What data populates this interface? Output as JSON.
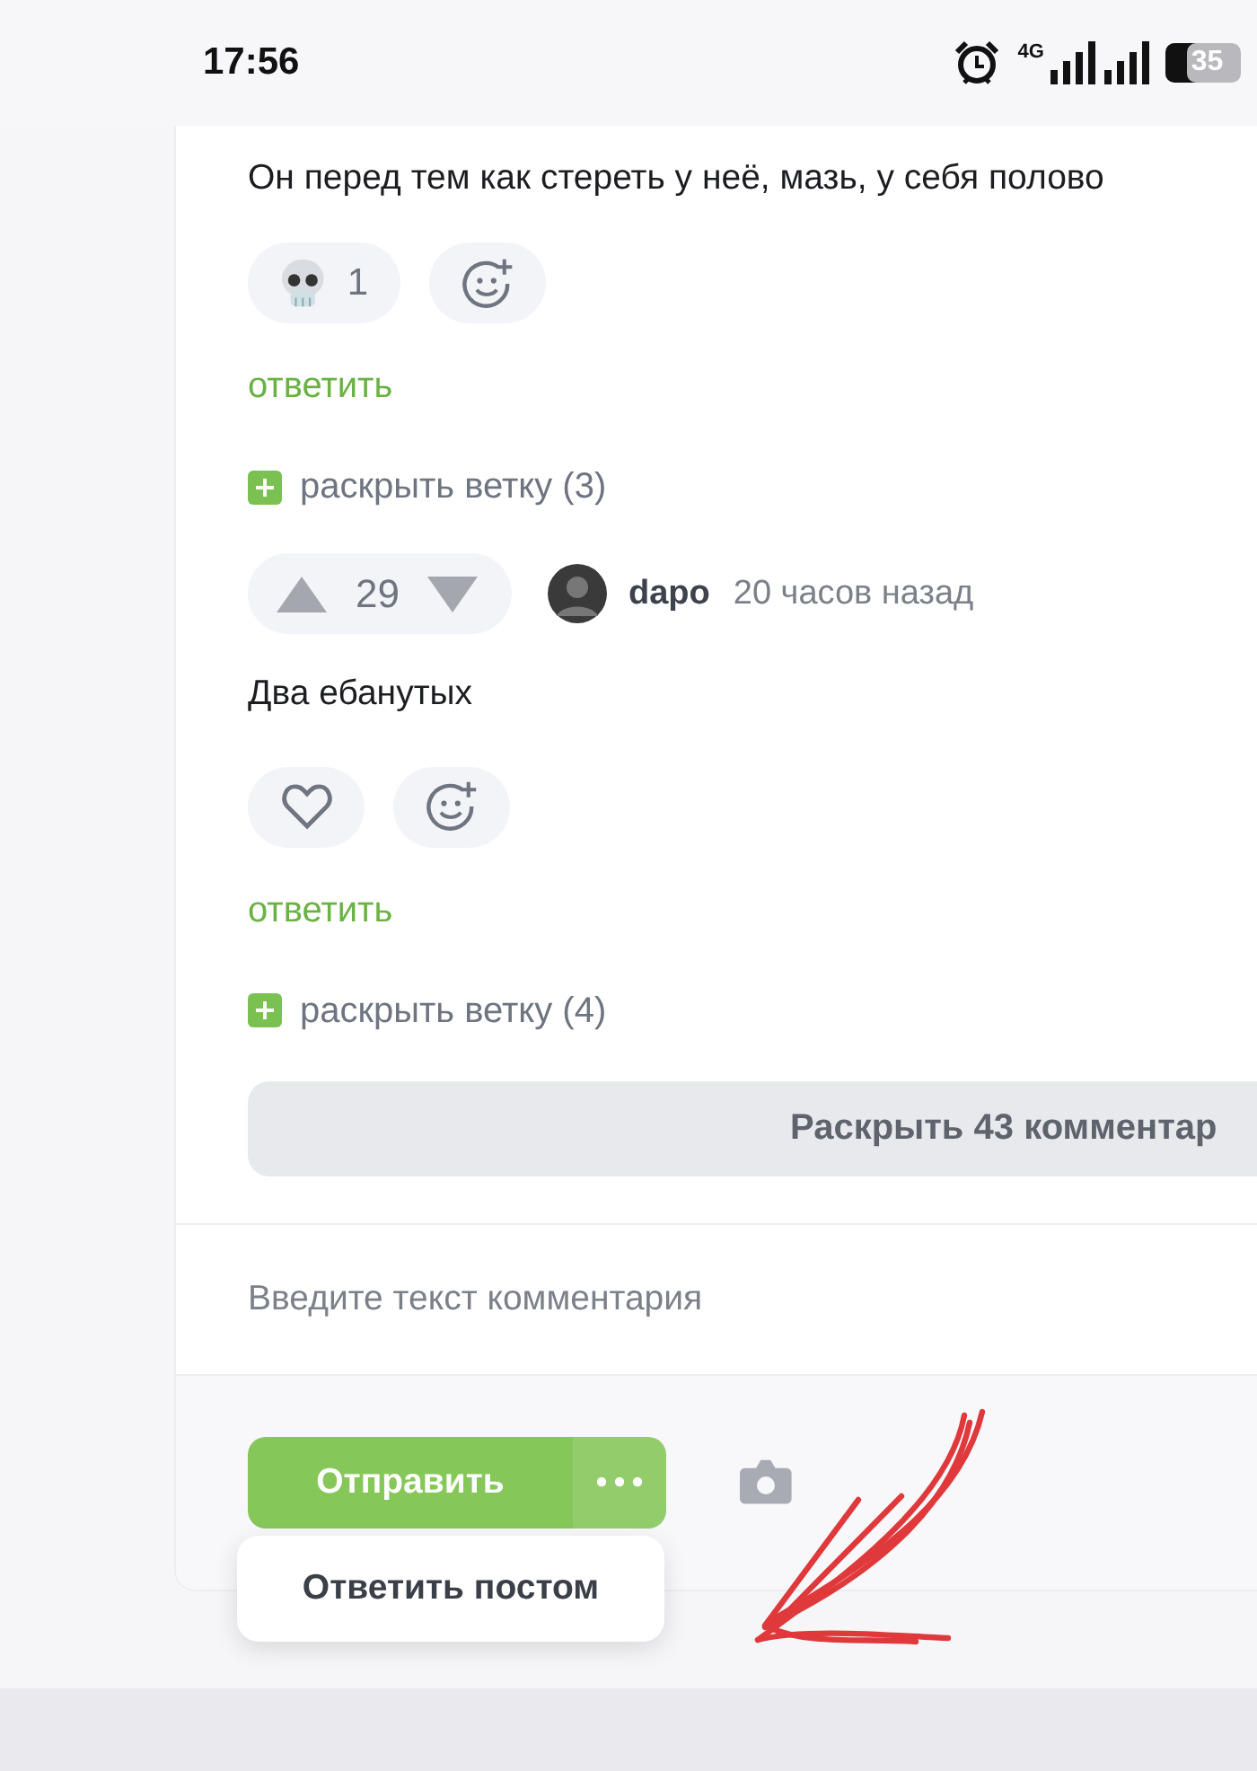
{
  "status_bar": {
    "time": "17:56",
    "network": "4G",
    "battery": "35"
  },
  "comments": [
    {
      "text": "Он перед тем как стереть у неё, мазь, у себя полово",
      "reactions": [
        {
          "kind": "skull",
          "count": "1"
        },
        {
          "kind": "add"
        }
      ],
      "reply": "ответить",
      "expand": "раскрыть ветку (3)"
    },
    {
      "header": {
        "votes": "29",
        "author": "dapo",
        "time": "20 часов назад"
      },
      "text": "Два ебанутых",
      "reactions": [
        {
          "kind": "like"
        },
        {
          "kind": "add"
        }
      ],
      "reply": "ответить",
      "expand": "раскрыть ветку (4)"
    }
  ],
  "show_more": "Раскрыть 43 комментар",
  "composer": {
    "placeholder": "Введите текст комментария",
    "send": "Отправить",
    "menu": [
      "Ответить постом"
    ]
  }
}
